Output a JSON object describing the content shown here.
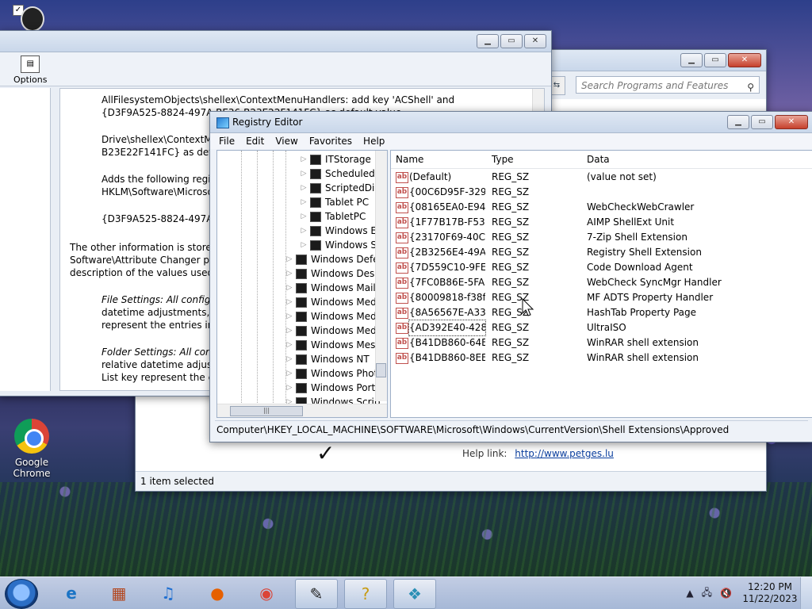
{
  "desktop": {
    "chrome_label": "Google Chrome"
  },
  "programs_window": {
    "search_placeholder": "Search Programs and Features",
    "help_label": "Help link:",
    "help_url": "http://www.petges.lu",
    "status": "1 item selected"
  },
  "help_window": {
    "options_label": "Options",
    "paragraphs": [
      "AllFilesystemObjects\\shellex\\ContextMenuHandlers: add key 'ACShell' and {D3F9A525-8824-497A-BE36-B23E22F141FC} as default value",
      "Drive\\shellex\\ContextM",
      "B23E22F141FC} as defa",
      "Adds the following regis",
      "HKLM\\Software\\Microso",
      "{D3F9A525-8824-497A-",
      "The other information is stored",
      "Software\\Attribute Changer pa",
      "description of the values used",
      "File Settings: All configu",
      "datetime adjustments, f",
      "represent the entries in",
      "Folder Settings: All conf",
      "relative datetime adjust",
      "List key represent the e"
    ]
  },
  "registry": {
    "title": "Registry Editor",
    "menu": [
      "File",
      "Edit",
      "View",
      "Favorites",
      "Help"
    ],
    "tree": [
      "ITStorage",
      "Scheduledl",
      "ScriptedDia",
      "Tablet PC",
      "TabletPC",
      "Windows E",
      "Windows S",
      "Windows Defe",
      "Windows Desk",
      "Windows Mail",
      "Windows Med",
      "Windows Med",
      "Windows Med",
      "Windows Mess",
      "Windows NT",
      "Windows Phot",
      "Windows Port",
      "Windows Scrip"
    ],
    "columns": {
      "name": "Name",
      "type": "Type",
      "data": "Data"
    },
    "rows": [
      {
        "name": "(Default)",
        "type": "REG_SZ",
        "data": "(value not set)"
      },
      {
        "name": "{00C6D95F-329C...",
        "type": "REG_SZ",
        "data": ""
      },
      {
        "name": "{08165EA0-E946...",
        "type": "REG_SZ",
        "data": "WebCheckWebCrawler"
      },
      {
        "name": "{1F77B17B-F531...",
        "type": "REG_SZ",
        "data": "AIMP ShellExt Unit"
      },
      {
        "name": "{23170F69-40C1...",
        "type": "REG_SZ",
        "data": "7-Zip Shell Extension"
      },
      {
        "name": "{2B3256E4-49AA...",
        "type": "REG_SZ",
        "data": "Registry Shell Extension"
      },
      {
        "name": "{7D559C10-9FE9...",
        "type": "REG_SZ",
        "data": "Code Download Agent"
      },
      {
        "name": "{7FC0B86E-5FA7...",
        "type": "REG_SZ",
        "data": "WebCheck SyncMgr Handler"
      },
      {
        "name": "{80009818-f38f-...",
        "type": "REG_SZ",
        "data": "MF ADTS Property Handler"
      },
      {
        "name": "{8A56567E-A333...",
        "type": "REG_SZ",
        "data": "HashTab Property Page"
      },
      {
        "name": "{AD392E40-428C...",
        "type": "REG_SZ",
        "data": "UltraISO"
      },
      {
        "name": "{B41DB860-64E4...",
        "type": "REG_SZ",
        "data": "WinRAR shell extension"
      },
      {
        "name": "{B41DB860-8EE4...",
        "type": "REG_SZ",
        "data": "WinRAR shell extension"
      }
    ],
    "path": "Computer\\HKEY_LOCAL_MACHINE\\SOFTWARE\\Microsoft\\Windows\\CurrentVersion\\Shell Extensions\\Approved"
  },
  "taskbar": {
    "time": "12:20 PM",
    "date": "11/22/2023"
  }
}
